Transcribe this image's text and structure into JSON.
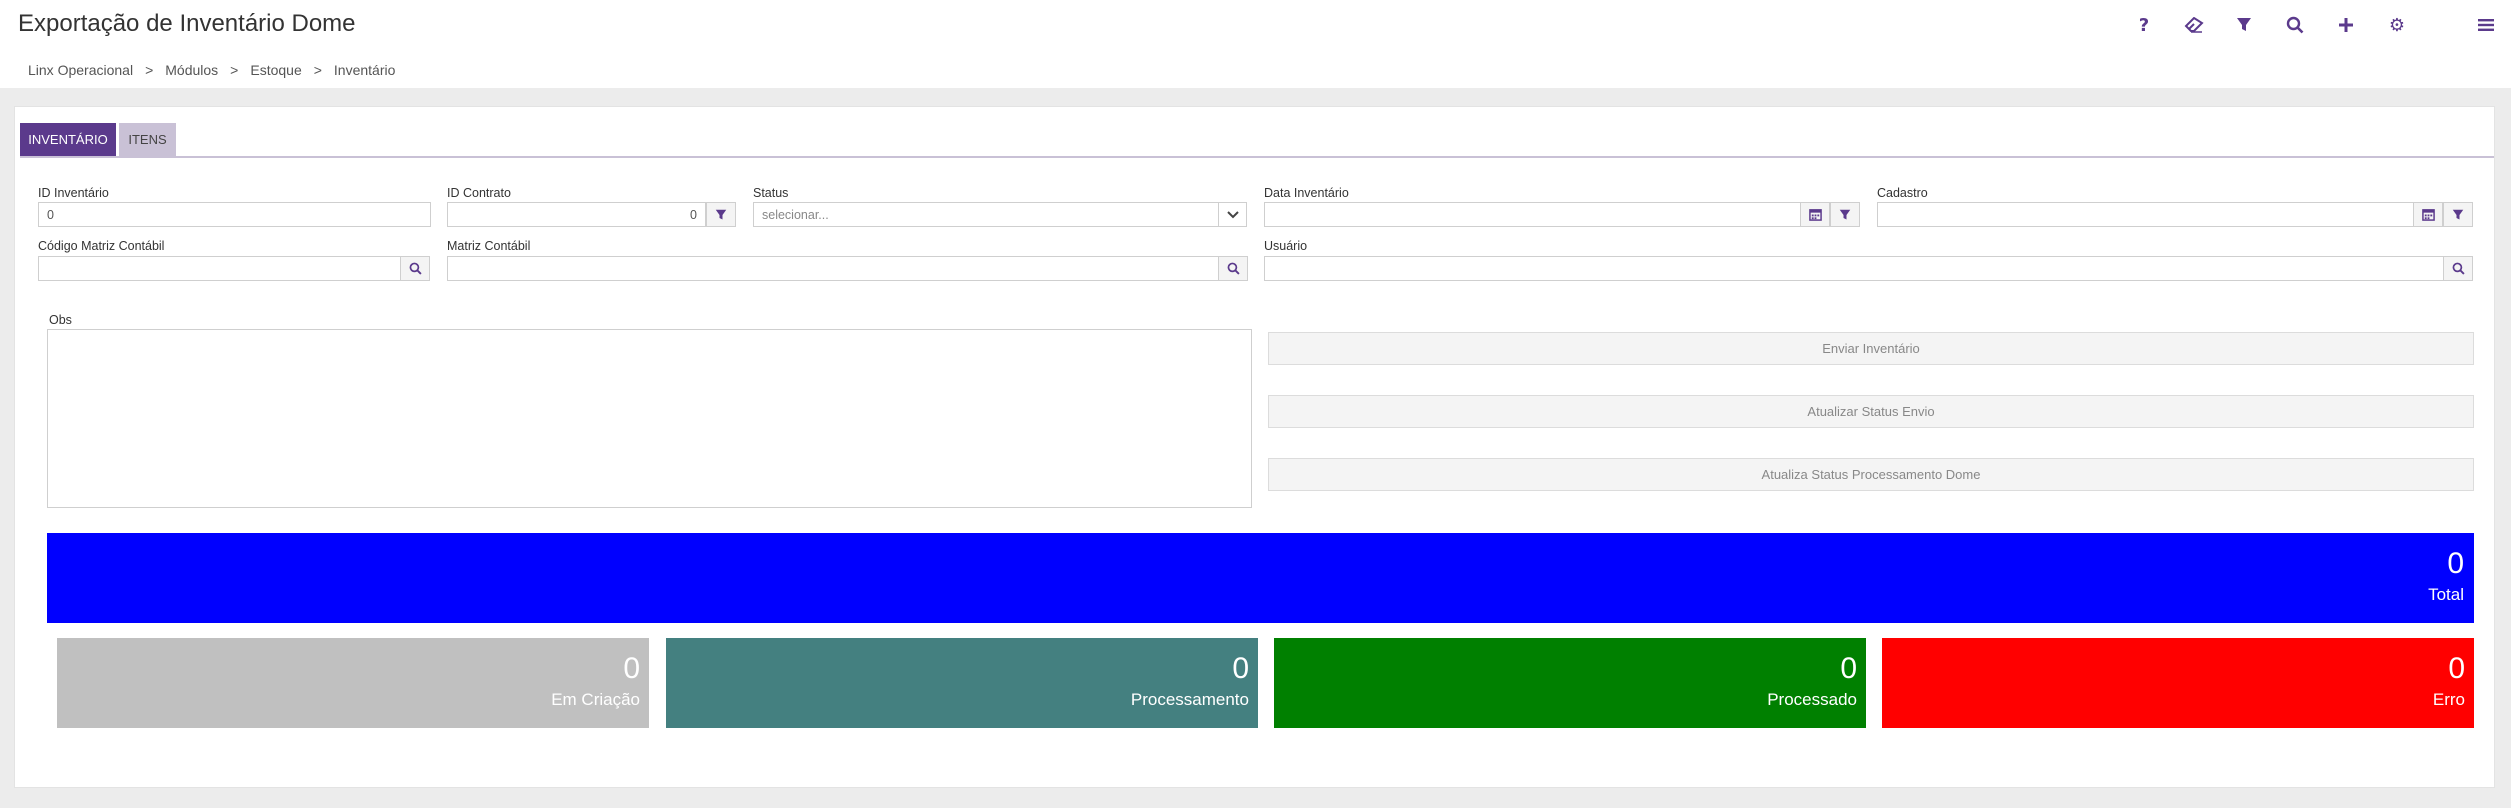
{
  "header": {
    "title": "Exportação de Inventário Dome",
    "icons": [
      "help-icon",
      "eraser-icon",
      "filter-icon",
      "search-icon",
      "plus-icon",
      "gear-icon",
      "menu-icon"
    ]
  },
  "breadcrumb": [
    "Linx Operacional",
    ">",
    "Módulos",
    ">",
    "Estoque",
    ">",
    "Inventário"
  ],
  "tabs": [
    {
      "label": "INVENTÁRIO",
      "active": true
    },
    {
      "label": "ITENS",
      "active": false
    }
  ],
  "form": {
    "id_inventario": {
      "label": "ID Inventário",
      "value": "0"
    },
    "id_contrato": {
      "label": "ID Contrato",
      "value": "0"
    },
    "status": {
      "label": "Status",
      "value": "selecionar..."
    },
    "data_inventario": {
      "label": "Data Inventário",
      "value": ""
    },
    "cadastro": {
      "label": "Cadastro",
      "value": ""
    },
    "codigo_matriz": {
      "label": "Código Matriz Contábil",
      "value": ""
    },
    "matriz_contabil": {
      "label": "Matriz Contábil",
      "value": ""
    },
    "usuario": {
      "label": "Usuário",
      "value": ""
    },
    "obs": {
      "label": "Obs",
      "value": ""
    }
  },
  "actions": {
    "enviar": "Enviar Inventário",
    "atualizar_envio": "Atualizar Status Envio",
    "atualiza_processamento": "Atualiza Status Processamento Dome"
  },
  "summary": {
    "total": {
      "value": "0",
      "label": "Total",
      "color": "#0000ff"
    },
    "cards": [
      {
        "value": "0",
        "label": "Em Criação",
        "color": "#c0c0c0"
      },
      {
        "value": "0",
        "label": "Processamento",
        "color": "#448080"
      },
      {
        "value": "0",
        "label": "Processado",
        "color": "#008000"
      },
      {
        "value": "0",
        "label": "Erro",
        "color": "#ff0000"
      }
    ]
  },
  "colors": {
    "accent": "#5b3a8c",
    "tab_inactive": "#c9c1d6"
  }
}
